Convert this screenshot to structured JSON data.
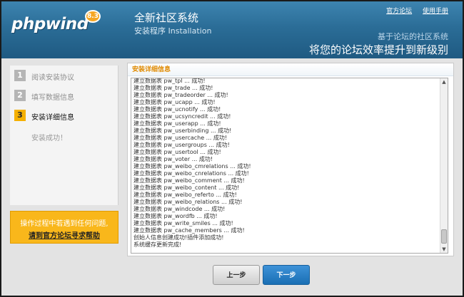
{
  "header": {
    "logo_text": "phpwind",
    "logo_version": "8.3",
    "title": "全新社区系统",
    "subtitle": "安装程序 Installation",
    "links": [
      "官方论坛",
      "使用手册"
    ],
    "slogan_small": "基于论坛的社区系统",
    "slogan_big": "将您的论坛效率提升到新级别"
  },
  "sidebar": {
    "steps": [
      {
        "num": "1",
        "label": "阅读安装协议"
      },
      {
        "num": "2",
        "label": "填写数据信息"
      },
      {
        "num": "3",
        "label": "安装详细信息"
      }
    ],
    "sub_status": "安装成功！",
    "help_line1": "操作过程中若遇到任何问题,",
    "help_line2": "请到官方论坛寻求帮助"
  },
  "panel": {
    "title": "安装详细信息",
    "log": [
      "建立数据表 pw_tpl ... 成功!",
      "建立数据表 pw_trade ... 成功!",
      "建立数据表 pw_tradeorder ... 成功!",
      "建立数据表 pw_ucapp ... 成功!",
      "建立数据表 pw_ucnotify ... 成功!",
      "建立数据表 pw_ucsyncredit ... 成功!",
      "建立数据表 pw_userapp ... 成功!",
      "建立数据表 pw_userbinding ... 成功!",
      "建立数据表 pw_usercache ... 成功!",
      "建立数据表 pw_usergroups ... 成功!",
      "建立数据表 pw_usertool ... 成功!",
      "建立数据表 pw_voter ... 成功!",
      "建立数据表 pw_weibo_cmrelations ... 成功!",
      "建立数据表 pw_weibo_cnrelations ... 成功!",
      "建立数据表 pw_weibo_comment ... 成功!",
      "建立数据表 pw_weibo_content ... 成功!",
      "建立数据表 pw_weibo_referto ... 成功!",
      "建立数据表 pw_weibo_relations ... 成功!",
      "建立数据表 pw_windcode ... 成功!",
      "建立数据表 pw_wordfb ... 成功!",
      "建立数据表 pw_write_smiles ... 成功!",
      "建立数据表 pw_cache_members ... 成功!",
      "创始人信息创建成功!插件添加成功!",
      "系统缓存更新完成!"
    ]
  },
  "buttons": {
    "prev": "上一步",
    "next": "下一步"
  }
}
